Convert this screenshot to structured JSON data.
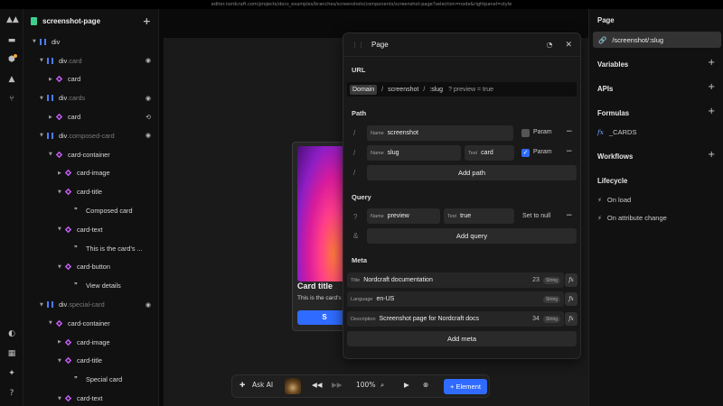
{
  "browser": {
    "url": "editor.nordcraft.com/projects/docs_examples/branches/screenshots/components/screenshot-page?selection=node&rightpanel=style"
  },
  "tree": {
    "page_name": "screenshot-page",
    "add_label": "+",
    "rows": [
      {
        "label": "div",
        "cls": ""
      },
      {
        "label": "div",
        "cls": ".card"
      },
      {
        "label": "card",
        "cls": ""
      },
      {
        "label": "div",
        "cls": ".cards"
      },
      {
        "label": "card",
        "cls": ""
      },
      {
        "label": "div",
        "cls": ".composed-card"
      },
      {
        "label": "card-container",
        "cls": ""
      },
      {
        "label": "card-image",
        "cls": ""
      },
      {
        "label": "card-title",
        "cls": ""
      },
      {
        "label": "Composed card",
        "cls": ""
      },
      {
        "label": "card-text",
        "cls": ""
      },
      {
        "label": "This is the card's ...",
        "cls": ""
      },
      {
        "label": "card-button",
        "cls": ""
      },
      {
        "label": "View details",
        "cls": ""
      },
      {
        "label": "div",
        "cls": ".special-card"
      },
      {
        "label": "card-container",
        "cls": ""
      },
      {
        "label": "card-image",
        "cls": ""
      },
      {
        "label": "card-title",
        "cls": ""
      },
      {
        "label": "Special card",
        "cls": ""
      },
      {
        "label": "card-text",
        "cls": ""
      }
    ]
  },
  "preview": {
    "card_title": "Card title",
    "card_text": "This is the card's",
    "card_button": "S"
  },
  "dialog": {
    "title": "Page",
    "url_section": "URL",
    "url": {
      "domain": "Domain",
      "seg1": "screenshot",
      "seg2": ":slug",
      "query": "? preview = true"
    },
    "path_section": "Path",
    "path": [
      {
        "label": "Name",
        "value": "screenshot",
        "param_label": "Param",
        "param_on": false
      },
      {
        "label": "Name",
        "value": "slug",
        "test_label": "Test",
        "test_value": "card",
        "param_label": "Param",
        "param_on": true
      }
    ],
    "add_path": "Add path",
    "query_section": "Query",
    "query": {
      "name_label": "Name",
      "name": "preview",
      "test_label": "Test",
      "test": "true",
      "set_null": "Set to null"
    },
    "add_query": "Add query",
    "meta_section": "Meta",
    "meta": [
      {
        "label": "Title",
        "value": "Nordcraft documentation",
        "count": "23",
        "type": "String"
      },
      {
        "label": "Language",
        "value": "en-US",
        "count": "",
        "type": "String"
      },
      {
        "label": "Description",
        "value": "Screenshot page for Nordcraft docs",
        "count": "34",
        "type": "String"
      }
    ],
    "add_meta": "Add meta",
    "fx": "fx",
    "slash": "/",
    "qmark": "?",
    "amp": "&",
    "minus": "−"
  },
  "toolbar": {
    "ask_ai": "Ask AI",
    "zoom": "100%",
    "add_element": "Element"
  },
  "right_panel": {
    "page_heading": "Page",
    "page_route": "/screenshot/:slug",
    "variables": "Variables",
    "apis": "APIs",
    "formulas": "Formulas",
    "formula_item": "_CARDS",
    "workflows": "Workflows",
    "lifecycle": "Lifecycle",
    "on_load": "On load",
    "on_attr": "On attribute change"
  },
  "colors": {
    "accent": "#2f6bff",
    "div_icon": "#4d7cff",
    "component_icon": "#c35cf3",
    "page_icon": "#3ecf8e",
    "link_icon": "#f5a623"
  }
}
